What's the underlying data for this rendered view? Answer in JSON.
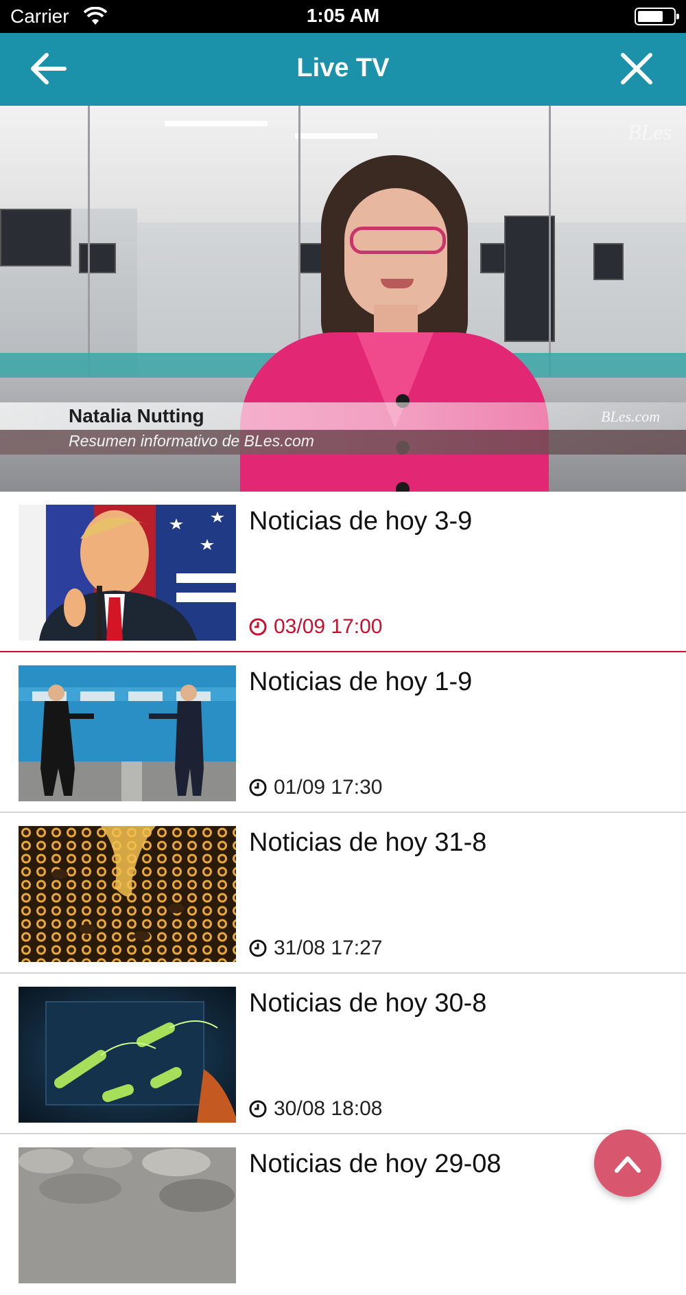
{
  "status_bar": {
    "carrier": "Carrier",
    "time": "1:05 AM"
  },
  "header": {
    "title": "Live TV",
    "back_icon": "arrow-left-icon",
    "close_icon": "close-icon"
  },
  "player": {
    "presenter_name": "Natalia Nutting",
    "caption": "Resumen informativo de BLes.com",
    "watermark": "BLes.com",
    "watermark_top": "BLes"
  },
  "videos": [
    {
      "title": "Noticias de hoy 3-9",
      "datetime": "03/09 17:00",
      "active": true
    },
    {
      "title": "Noticias de hoy 1-9",
      "datetime": "01/09 17:30",
      "active": false
    },
    {
      "title": "Noticias de hoy 31-8",
      "datetime": "31/08 17:27",
      "active": false
    },
    {
      "title": "Noticias de hoy 30-8",
      "datetime": "30/08 18:08",
      "active": false
    },
    {
      "title": "Noticias de hoy 29-08",
      "datetime": "",
      "active": false
    }
  ],
  "fab_icon": "chevron-up-icon",
  "colors": {
    "header": "#1b92aa",
    "active_accent": "#c8102e",
    "fab": "#d9566f"
  }
}
